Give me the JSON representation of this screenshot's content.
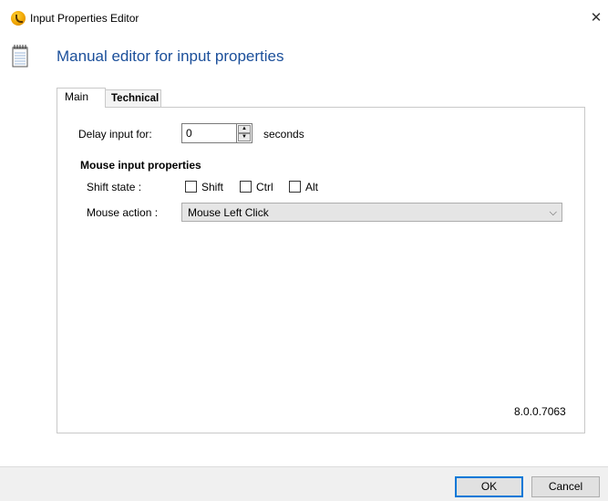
{
  "window": {
    "title": "Input Properties Editor",
    "close_glyph": "✕",
    "icon": "app-icon"
  },
  "header": {
    "title": "Manual editor for input properties",
    "icon": "notepad-icon"
  },
  "tabs": [
    {
      "label": "Main",
      "selected": true
    },
    {
      "label": "Technical",
      "selected": false
    }
  ],
  "main": {
    "delay_label": "Delay input for:",
    "delay_value": "0",
    "delay_unit": "seconds",
    "section_title": "Mouse input properties",
    "shift_state_label": "Shift state :",
    "modifiers": [
      {
        "label": "Shift",
        "checked": false
      },
      {
        "label": "Ctrl",
        "checked": false
      },
      {
        "label": "Alt",
        "checked": false
      }
    ],
    "mouse_action_label": "Mouse action :",
    "mouse_action_value": "Mouse Left Click",
    "version": "8.0.0.7063"
  },
  "footer": {
    "ok_label": "OK",
    "cancel_label": "Cancel"
  },
  "colors": {
    "header_title": "#1b4f9a",
    "default_button_border": "#0078d7"
  }
}
